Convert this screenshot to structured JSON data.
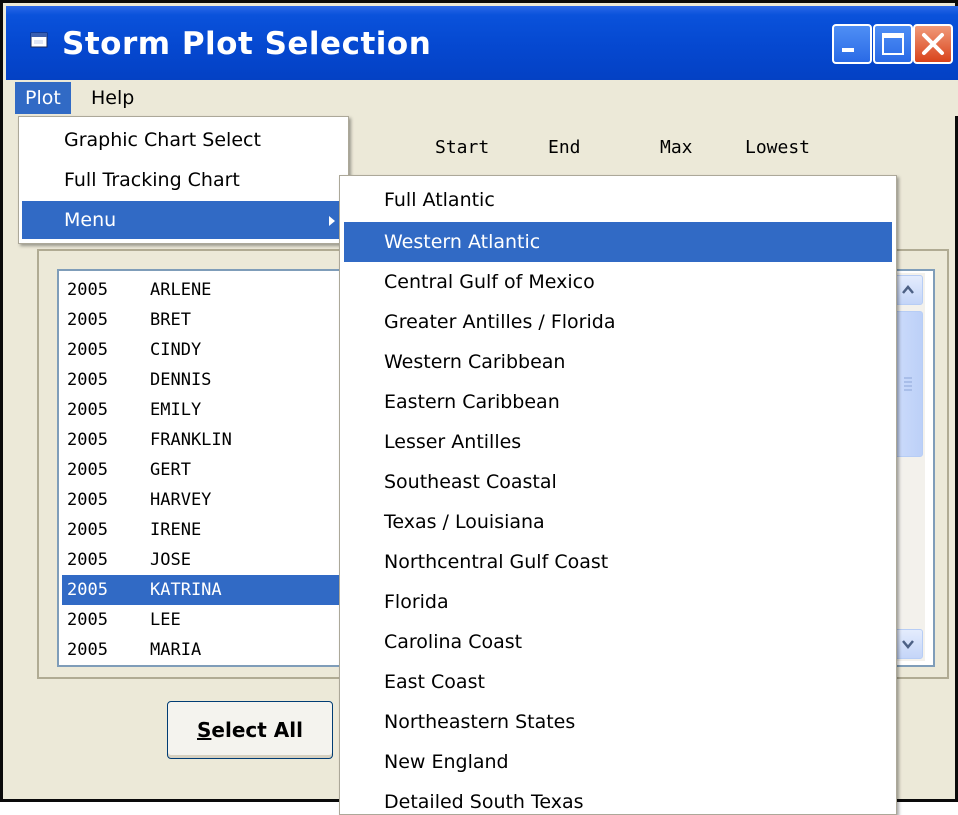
{
  "window": {
    "title": "Storm Plot Selection"
  },
  "menubar": {
    "items": [
      "Plot",
      "Help"
    ]
  },
  "column_headers": [
    "Start",
    "End",
    "Max",
    "Lowest"
  ],
  "plot_menu": {
    "items": [
      "Graphic Chart Select",
      "Full Tracking Chart",
      "Menu"
    ],
    "highlighted": "Menu"
  },
  "submenu": {
    "items": [
      "Full Atlantic",
      "Western Atlantic",
      "Central Gulf of Mexico",
      "Greater Antilles / Florida",
      "Western Caribbean",
      "Eastern Caribbean",
      "Lesser Antilles",
      "Southeast Coastal",
      "Texas / Louisiana",
      "Northcentral Gulf Coast",
      "Florida",
      "Carolina Coast",
      "East Coast",
      "Northeastern States",
      "New England",
      "Detailed South Texas"
    ],
    "highlighted": "Western Atlantic"
  },
  "storms": [
    {
      "year": "2005",
      "name": "ARLENE"
    },
    {
      "year": "2005",
      "name": "BRET"
    },
    {
      "year": "2005",
      "name": "CINDY"
    },
    {
      "year": "2005",
      "name": "DENNIS"
    },
    {
      "year": "2005",
      "name": "EMILY"
    },
    {
      "year": "2005",
      "name": "FRANKLIN"
    },
    {
      "year": "2005",
      "name": "GERT"
    },
    {
      "year": "2005",
      "name": "HARVEY"
    },
    {
      "year": "2005",
      "name": "IRENE"
    },
    {
      "year": "2005",
      "name": "JOSE"
    },
    {
      "year": "2005",
      "name": "KATRINA"
    },
    {
      "year": "2005",
      "name": "LEE"
    },
    {
      "year": "2005",
      "name": "MARIA"
    }
  ],
  "selected_storm": "KATRINA",
  "buttons": {
    "select_all": "Select All"
  },
  "colors": {
    "title_bar": "#0548d0",
    "menu_highlight": "#316ac5",
    "window_bg": "#ece9d8"
  }
}
